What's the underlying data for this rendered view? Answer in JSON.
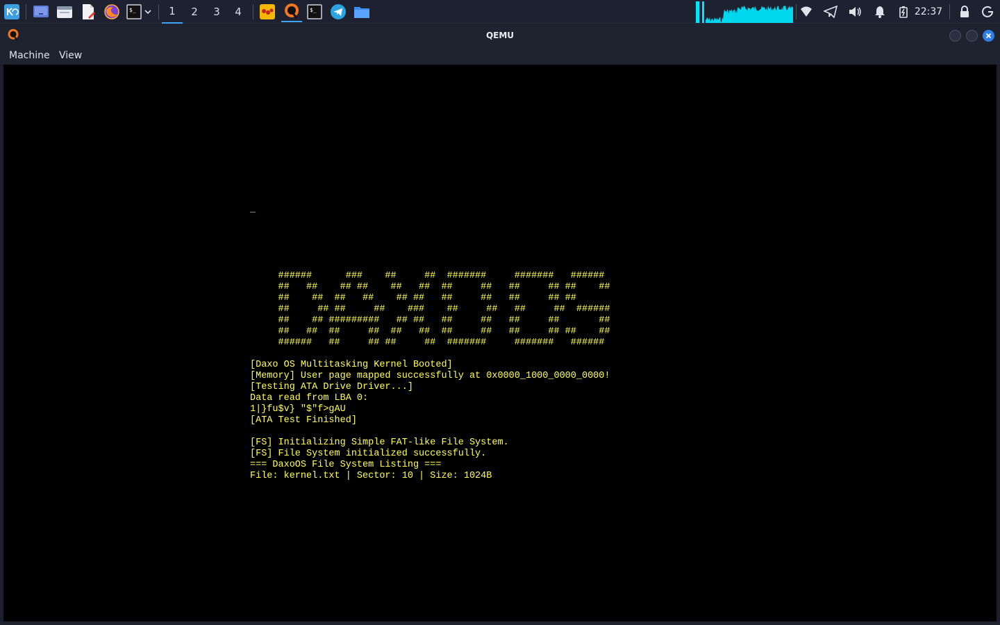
{
  "window": {
    "title": "QEMU"
  },
  "menubar": {
    "items": [
      "Machine",
      "View"
    ]
  },
  "panel": {
    "workspaces": [
      "1",
      "2",
      "3",
      "4"
    ],
    "active_workspace": "1",
    "clock": "22:37",
    "launchers": [
      "kde-icon",
      "desktop-icon",
      "file-manager-icon",
      "document-editor-icon",
      "firefox-icon",
      "terminal-icon"
    ],
    "tasks": [
      "office-app-icon",
      "qemu-icon",
      "terminal-icon",
      "telegram-icon",
      "folder-icon"
    ],
    "tray": [
      "network-icon",
      "telegram-tray-icon",
      "volume-icon",
      "notification-icon",
      "battery-icon"
    ],
    "colors": {
      "accent": "#3ea6ff",
      "graph": "#00e5ff"
    }
  },
  "console": {
    "color": "#ffff55",
    "cursor": "_",
    "lines": [
      "",
      "",
      "",
      "",
      "",
      "     ######      ###    ##     ##  #######     #######   ######",
      "     ##   ##    ## ##    ##   ##  ##     ##   ##     ## ##    ##",
      "     ##    ##  ##   ##    ## ##   ##     ##   ##     ## ##",
      "     ##     ## ##     ##    ###    ##     ##   ##     ##  ######",
      "     ##    ## #########   ## ##   ##     ##   ##     ##       ##",
      "     ##   ##  ##     ##  ##   ##  ##     ##   ##     ## ##    ##",
      "     ######   ##     ## ##     ##  #######     #######   ######",
      "",
      "[Daxo OS Multitasking Kernel Booted]",
      "[Memory] User page mapped successfully at 0x0000_1000_0000_0000!",
      "[Testing ATA Drive Driver...]",
      "Data read from LBA 0:",
      "1|}fu$v} \"$\"f>gAU",
      "[ATA Test Finished]",
      "",
      "[FS] Initializing Simple FAT-like File System.",
      "[FS] File System initialized successfully.",
      "=== DaxoOS File System Listing ===",
      "File: kernel.txt | Sector: 10 | Size: 1024B"
    ]
  }
}
